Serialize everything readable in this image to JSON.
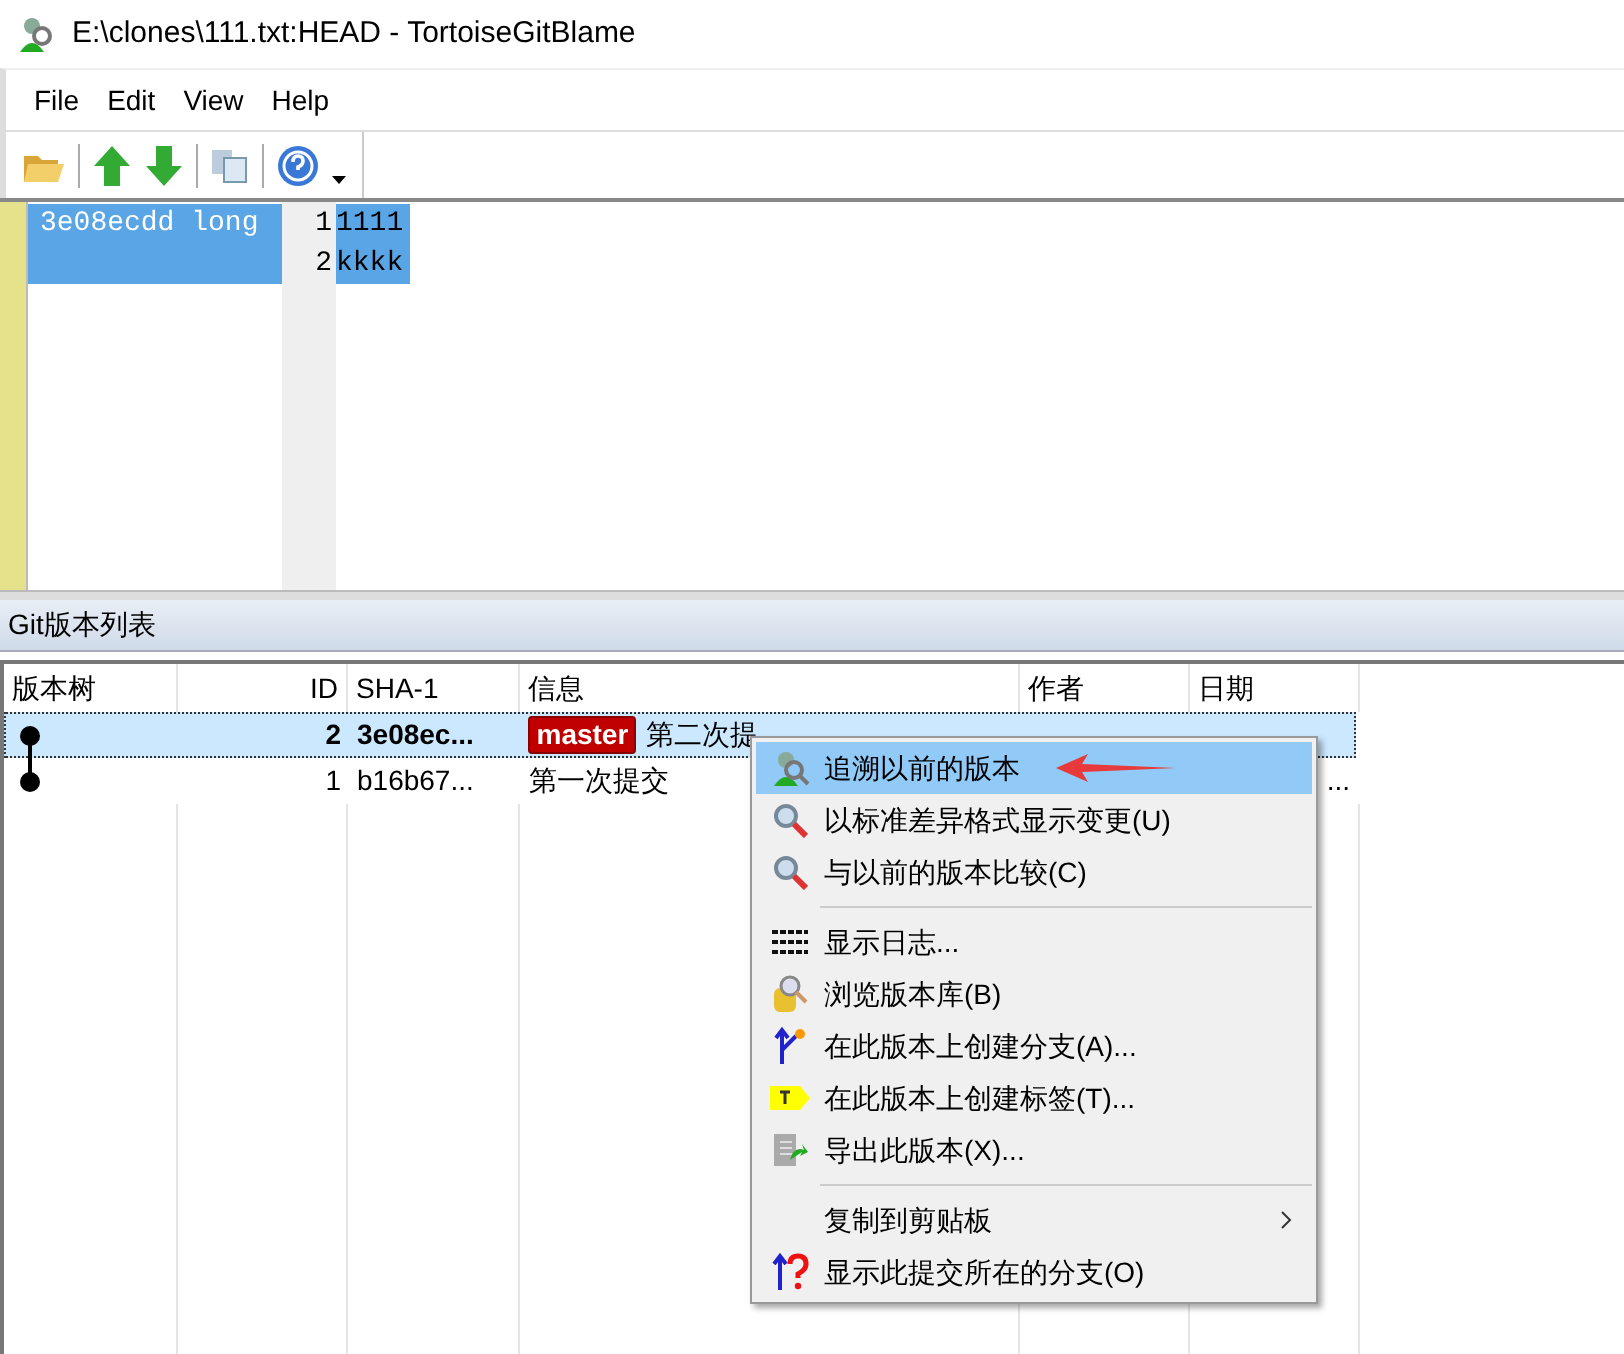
{
  "window": {
    "title": "E:\\clones\\111.txt:HEAD - TortoiseGitBlame"
  },
  "menu_bar": [
    "File",
    "Edit",
    "View",
    "Help"
  ],
  "blame": {
    "lines": [
      {
        "author": "3e08ecdd long",
        "number": "1",
        "text": "1111",
        "selected": true
      },
      {
        "number": "2",
        "text": "kkkk",
        "selected": true
      }
    ]
  },
  "log_panel": {
    "title": "Git版本列表",
    "columns": [
      "版本树",
      "ID",
      "SHA-1",
      "信息",
      "作者",
      "日期"
    ],
    "rows": [
      {
        "id": "2",
        "sha": "3e08ec...",
        "branch": "master",
        "message": "第二次提",
        "selected": true
      },
      {
        "id": "1",
        "sha": "b16b67...",
        "message": "第一次提交",
        "date": "...",
        "selected": false
      }
    ]
  },
  "context_menu": {
    "items": [
      {
        "kind": "blame",
        "label": "追溯以前的版本",
        "selected": true
      },
      {
        "kind": "diff",
        "label": "以标准差异格式显示变更(U)",
        "selected": false
      },
      {
        "kind": "diff",
        "label": "与以前的版本比较(C)",
        "selected": false
      },
      {
        "kind": "separator"
      },
      {
        "kind": "log",
        "label": "显示日志...",
        "selected": false
      },
      {
        "kind": "browse",
        "label": "浏览版本库(B)",
        "selected": false
      },
      {
        "kind": "branch",
        "label": "在此版本上创建分支(A)...",
        "selected": false
      },
      {
        "kind": "tag",
        "label": "在此版本上创建标签(T)...",
        "selected": false
      },
      {
        "kind": "export",
        "label": "导出此版本(X)...",
        "selected": false
      },
      {
        "kind": "separator"
      },
      {
        "kind": "submenu",
        "label": "复制到剪贴板",
        "selected": false
      },
      {
        "kind": "branches",
        "label": "显示此提交所在的分支(O)",
        "selected": false
      }
    ]
  }
}
